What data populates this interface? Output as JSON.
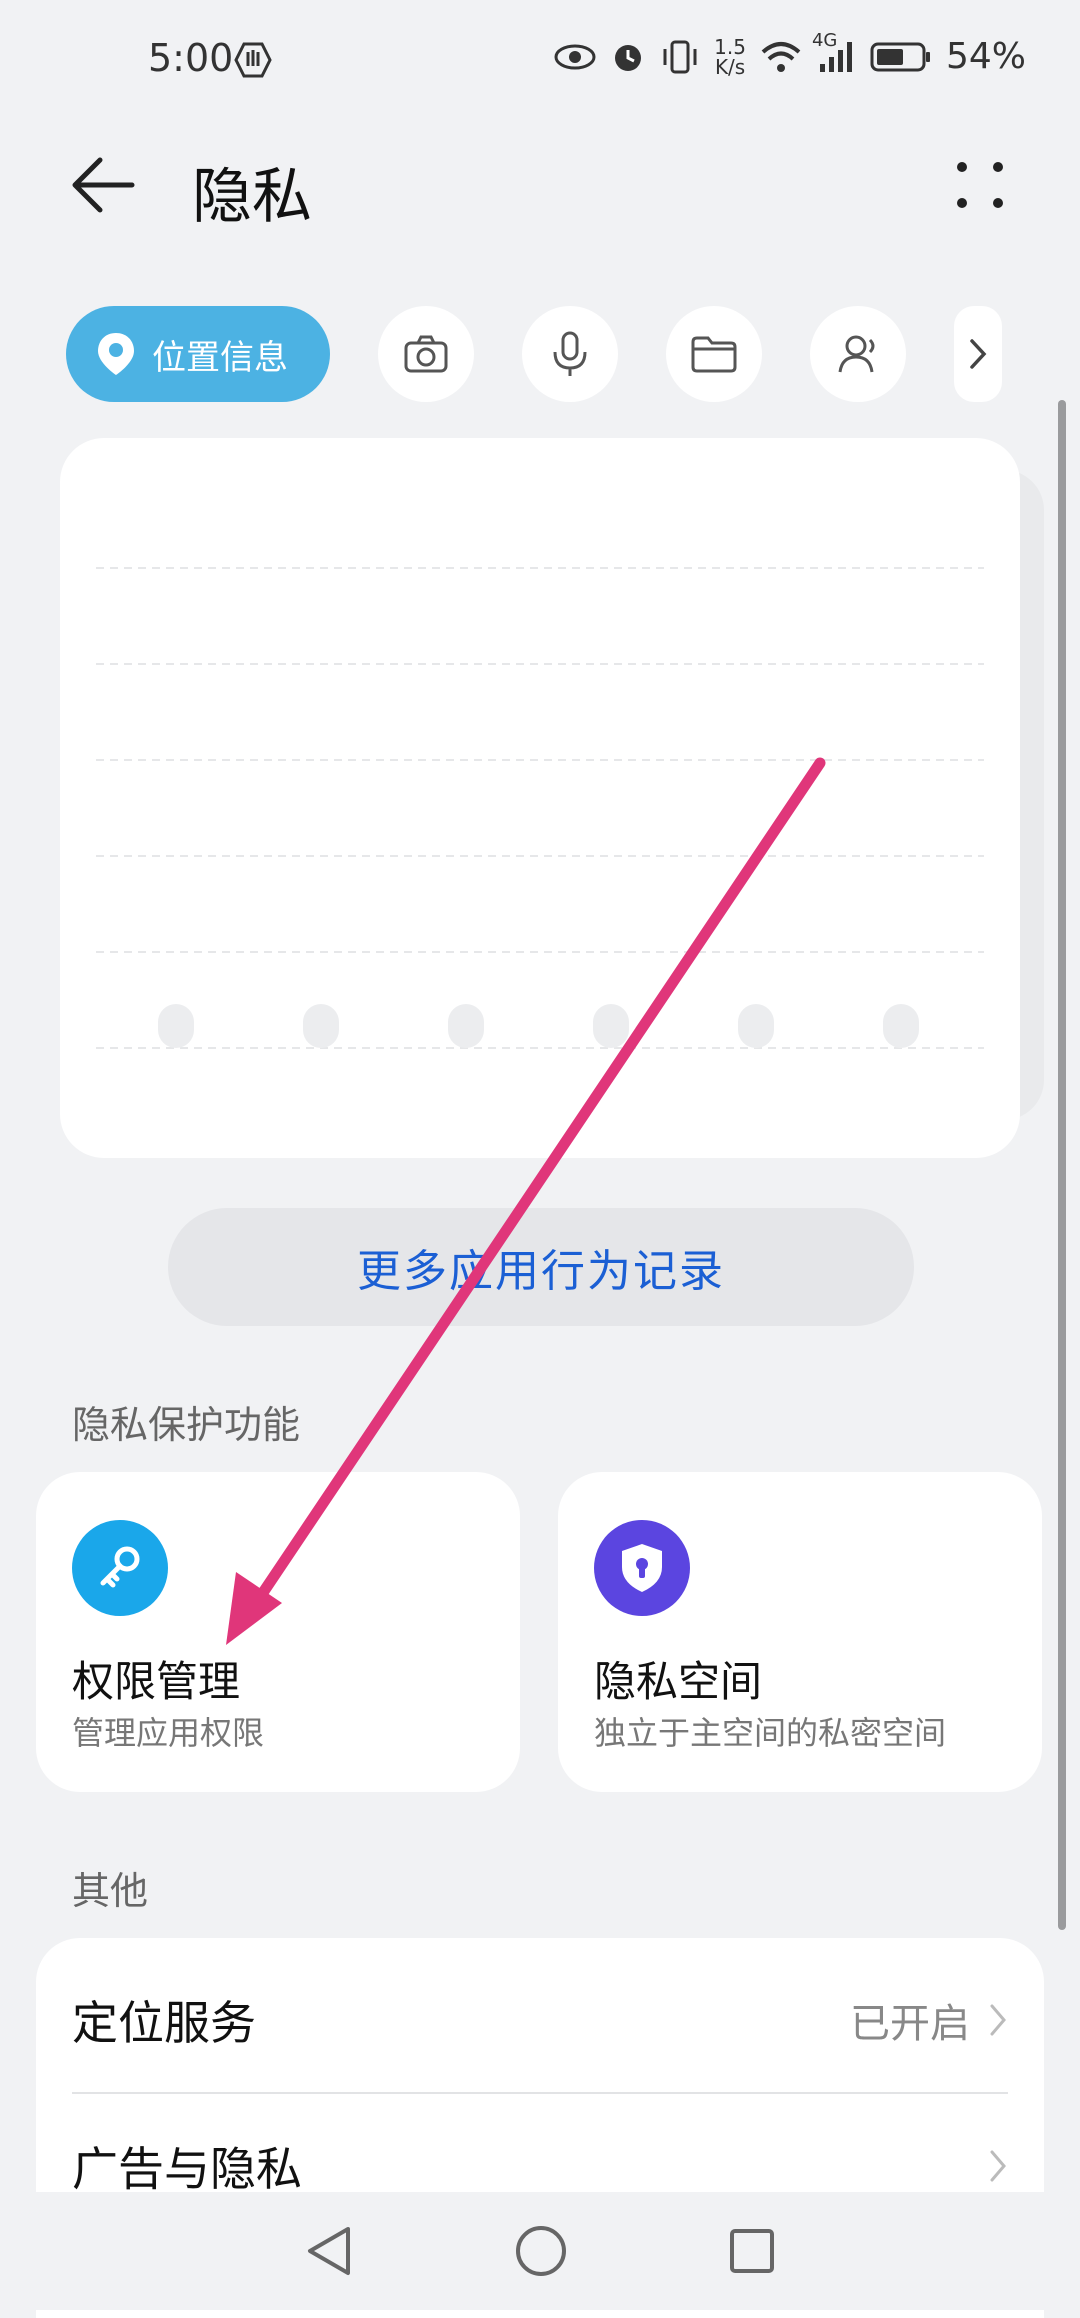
{
  "status_bar": {
    "time": "5:00",
    "network_speed_value": "1.5",
    "network_speed_unit": "K/s",
    "network_type": "4G",
    "battery": "54%"
  },
  "header": {
    "title": "隐私"
  },
  "tabs": {
    "selected_label": "位置信息",
    "items": [
      "location-icon",
      "camera-icon",
      "microphone-icon",
      "folder-icon",
      "contacts-icon"
    ]
  },
  "more_records_button": "更多应用行为记录",
  "privacy_section": {
    "title": "隐私保护功能",
    "cards": [
      {
        "title": "权限管理",
        "subtitle": "管理应用权限",
        "icon": "key-icon",
        "color": "#1aa7ea"
      },
      {
        "title": "隐私空间",
        "subtitle": "独立于主空间的私密空间",
        "icon": "shield-lock-icon",
        "color": "#5b45e0"
      }
    ]
  },
  "other_section": {
    "title": "其他",
    "items": [
      {
        "label": "定位服务",
        "value": "已开启"
      },
      {
        "label": "广告与隐私",
        "value": ""
      }
    ]
  },
  "annotation": {
    "color": "#e0367a"
  }
}
